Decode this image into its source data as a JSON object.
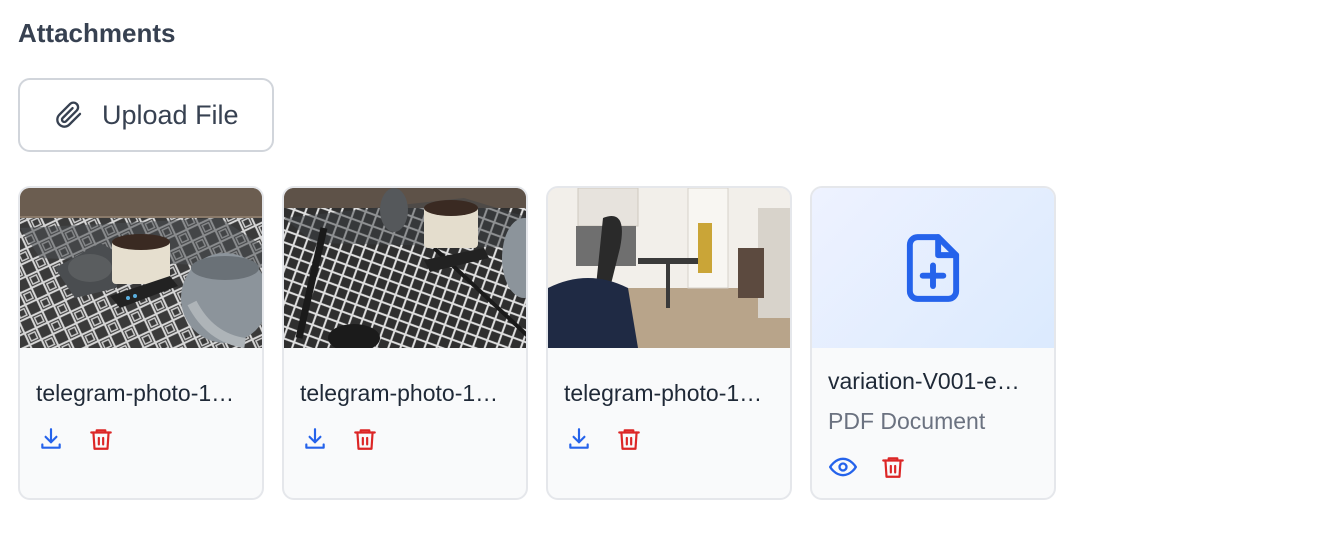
{
  "section": {
    "title": "Attachments"
  },
  "upload": {
    "label": "Upload File",
    "icon": "paperclip-icon"
  },
  "attachments": [
    {
      "name": "telegram-photo-1…",
      "kind": "image",
      "actions": [
        "download-icon",
        "trash-icon"
      ]
    },
    {
      "name": "telegram-photo-1…",
      "kind": "image",
      "actions": [
        "download-icon",
        "trash-icon"
      ]
    },
    {
      "name": "telegram-photo-1…",
      "kind": "image",
      "actions": [
        "download-icon",
        "trash-icon"
      ]
    },
    {
      "name": "variation-V001-e…",
      "kind": "document",
      "type_label": "PDF Document",
      "actions": [
        "eye-icon",
        "trash-icon"
      ]
    }
  ],
  "colors": {
    "accent": "#2563eb",
    "danger": "#dc2626",
    "border": "#e5e7eb",
    "muted": "#6b7280"
  }
}
